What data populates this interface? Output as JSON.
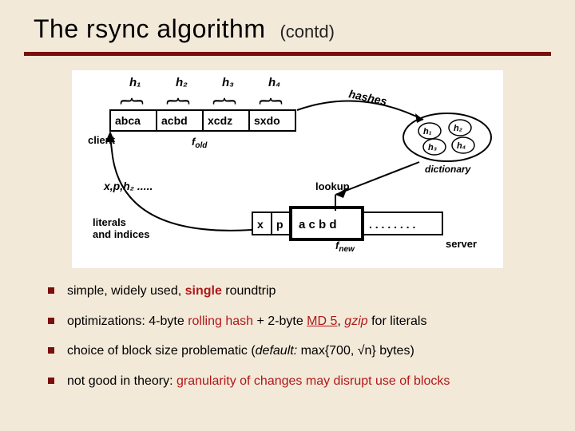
{
  "title": {
    "main": "The rsync algorithm",
    "sub": "(contd)"
  },
  "diagram": {
    "hashes_top": [
      "h₁",
      "h₂",
      "h₃",
      "h₄"
    ],
    "blocks_old": [
      "abca",
      "acbd",
      "xcdz",
      "sxdo"
    ],
    "client_label": "client",
    "f_old": "f_old",
    "stream": "x,p,h₂ .....",
    "literals_label": "literals\nand indices",
    "lookup_label": "lookup",
    "new_blocks": [
      "x",
      "p",
      "a c b d",
      ". . . . . . . . "
    ],
    "f_new": "f_new",
    "server_label": "server",
    "hashes_label": "hashes",
    "dict_label": "dictionary",
    "dict_items": [
      "h₁",
      "h₂",
      "h₃",
      "h₄"
    ]
  },
  "bullets": {
    "b1": {
      "pre": "simple, widely used, ",
      "single": "single",
      "post": " roundtrip"
    },
    "b2": {
      "pre": "optimizations: 4-byte ",
      "roll": "rolling hash",
      "mid": " + 2-byte ",
      "md5": "MD 5",
      "mid2": ", ",
      "gzip": "gzip",
      "post": " for literals"
    },
    "b3": {
      "pre": "choice of block size problematic  (",
      "def": "default:",
      "post": " max{700, √n}  bytes)"
    },
    "b4": {
      "pre": "not good in theory: ",
      "red": "granularity of changes may disrupt use of blocks"
    }
  }
}
